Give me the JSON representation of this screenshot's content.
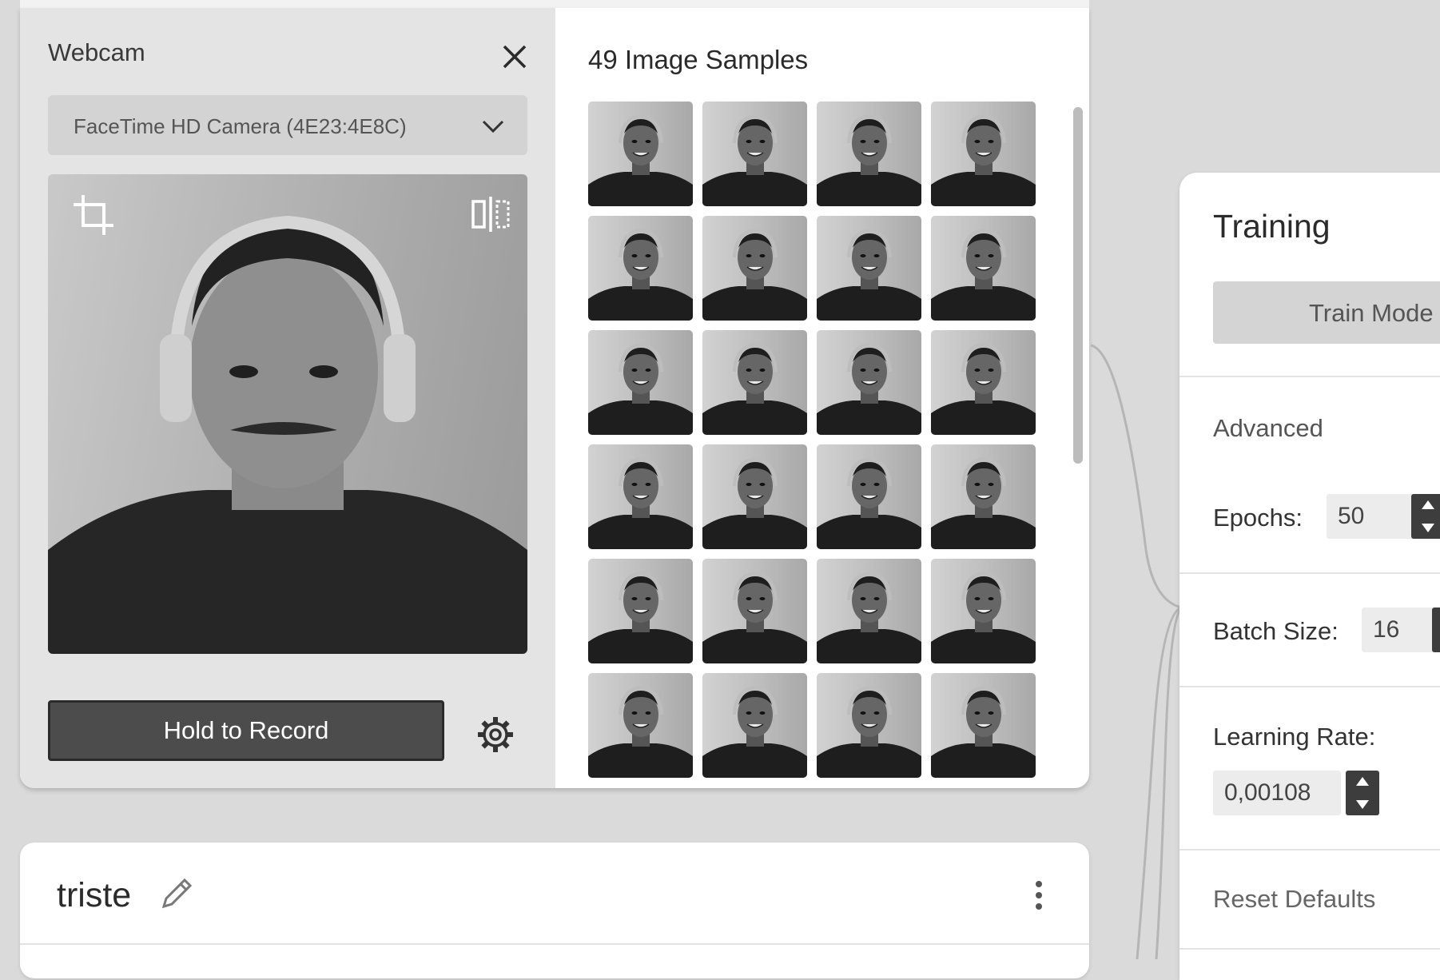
{
  "webcam": {
    "title": "Webcam",
    "camera_select": "FaceTime HD Camera (4E23:4E8C)",
    "record_button": "Hold to Record"
  },
  "samples": {
    "title": "49 Image Samples",
    "visible_thumbnails": 24
  },
  "class_card": {
    "name": "triste"
  },
  "training": {
    "title": "Training",
    "train_button": "Train Mode",
    "advanced_label": "Advanced",
    "epochs_label": "Epochs:",
    "epochs_value": "50",
    "batch_size_label": "Batch Size:",
    "batch_size_value": "16",
    "learning_rate_label": "Learning Rate:",
    "learning_rate_value": "0,00108",
    "reset_label": "Reset Defaults"
  },
  "colors": {
    "background": "#dadada",
    "record_button": "#4c4c4c",
    "panel": "#ffffff"
  }
}
